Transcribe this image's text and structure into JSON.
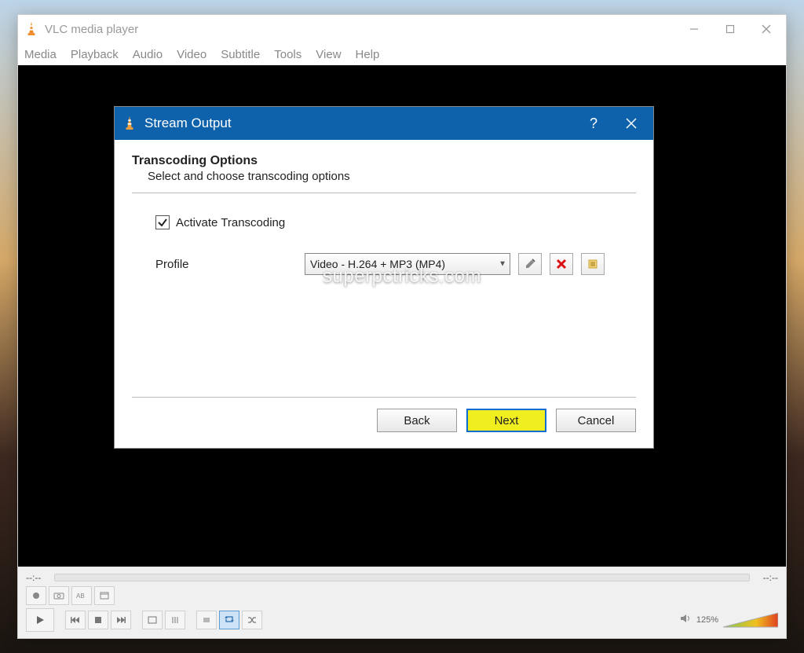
{
  "window": {
    "title": "VLC media player"
  },
  "menubar": {
    "items": [
      "Media",
      "Playback",
      "Audio",
      "Video",
      "Subtitle",
      "Tools",
      "View",
      "Help"
    ]
  },
  "seekbar": {
    "left_time": "--:--",
    "right_time": "--:--"
  },
  "volume": {
    "percent": "125%"
  },
  "dialog": {
    "title": "Stream Output",
    "heading": "Transcoding Options",
    "subheading": "Select and choose transcoding options",
    "checkbox_label": "Activate Transcoding",
    "checkbox_checked": true,
    "profile_label": "Profile",
    "profile_value": "Video - H.264 + MP3 (MP4)",
    "buttons": {
      "back": "Back",
      "next": "Next",
      "cancel": "Cancel"
    }
  },
  "watermark": "superpctricks.com"
}
